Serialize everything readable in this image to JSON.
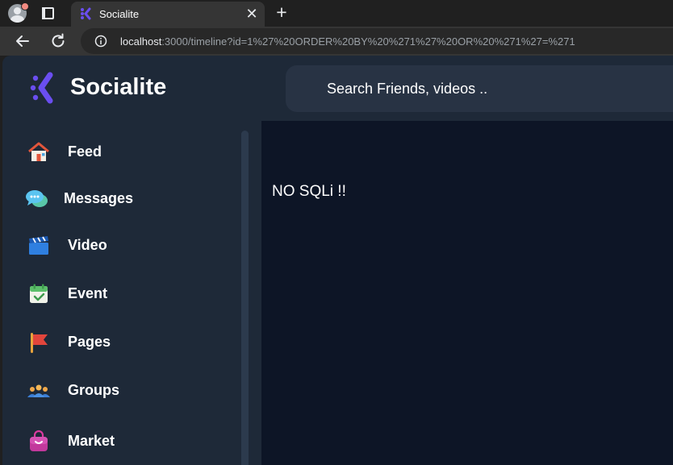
{
  "browser": {
    "tab_title": "Socialite",
    "tab_close_glyph": "✕",
    "new_tab_glyph": "+",
    "url_host": "localhost",
    "url_rest": ":3000/timeline?id=1%27%20ORDER%20BY%20%271%27%20OR%20%271%27=%271",
    "icons": {
      "profile": "profile-avatar-icon",
      "tab_actions": "tab-actions-icon",
      "back": "back-arrow-icon",
      "reload": "reload-icon",
      "site_info": "info-icon"
    }
  },
  "app": {
    "brand": "Socialite",
    "accent_color": "#6a4ef0",
    "search_placeholder": "Search Friends, videos ..",
    "sidebar": {
      "items": [
        {
          "label": "Feed",
          "icon": "house-icon"
        },
        {
          "label": "Messages",
          "icon": "chat-bubble-icon"
        },
        {
          "label": "Video",
          "icon": "clapperboard-icon"
        },
        {
          "label": "Event",
          "icon": "calendar-check-icon"
        },
        {
          "label": "Pages",
          "icon": "flag-icon"
        },
        {
          "label": "Groups",
          "icon": "people-group-icon"
        },
        {
          "label": "Market",
          "icon": "shopping-bag-icon"
        }
      ]
    },
    "main": {
      "message": "NO SQLi !!"
    }
  }
}
